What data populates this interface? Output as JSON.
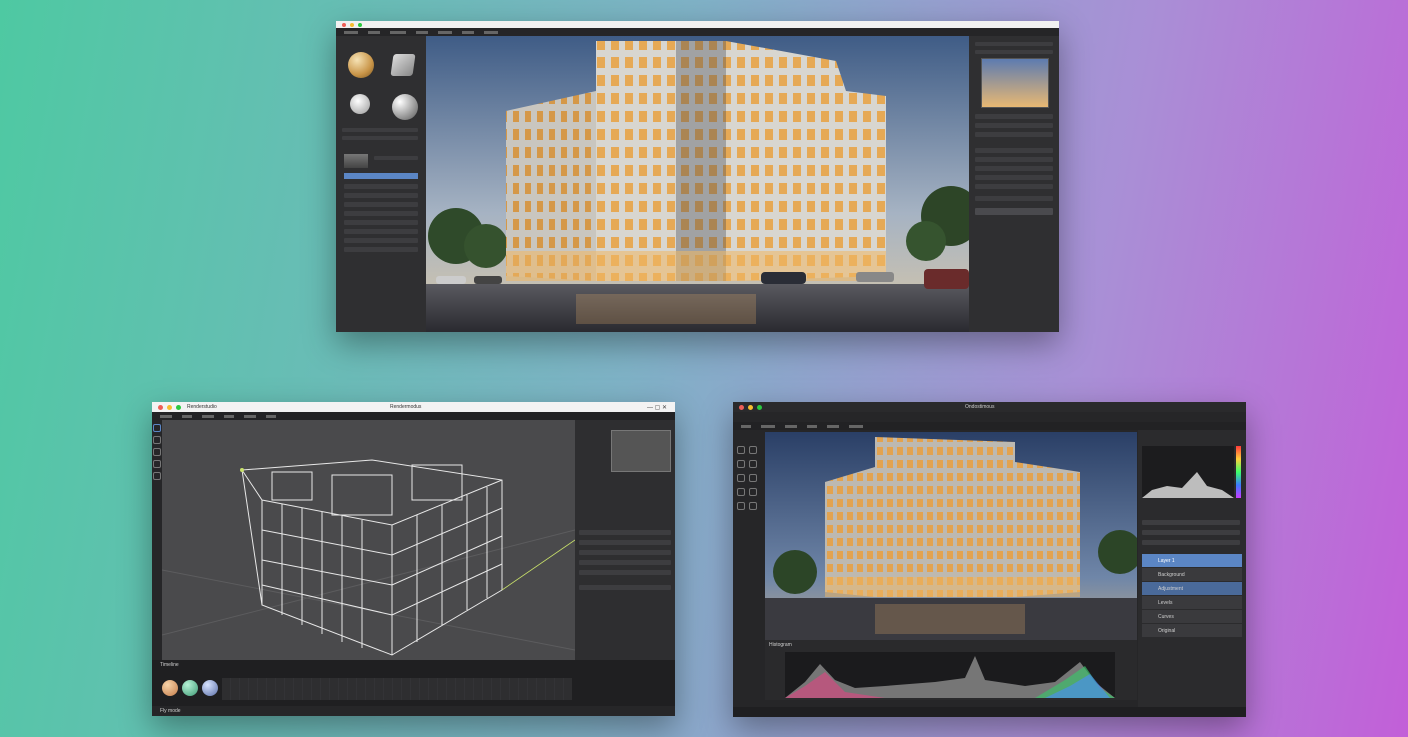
{
  "windows": {
    "render": {
      "title": "",
      "colors": {
        "titlebar": "#f1f1f1",
        "dot1": "#ee5f57",
        "dot2": "#f7be2f",
        "dot3": "#2ac940"
      }
    },
    "modeler": {
      "title": "Renderstudio",
      "center_title": "Rendermodus",
      "timeline_label": "Timeline",
      "status_label": "Fly mode",
      "colors": {
        "titlebar": "#f3f3f3",
        "wire": "#e8e8e8",
        "accent": "#c8e06a"
      }
    },
    "editor": {
      "title": "Ondostimous",
      "histogram_label": "Histogram",
      "layers": [
        "Layer 1",
        "Background",
        "Adjustment",
        "Levels",
        "Curves",
        "Original"
      ],
      "colors": {
        "titlebar": "#2a2a2c",
        "accent": "#5b86c5"
      }
    }
  }
}
